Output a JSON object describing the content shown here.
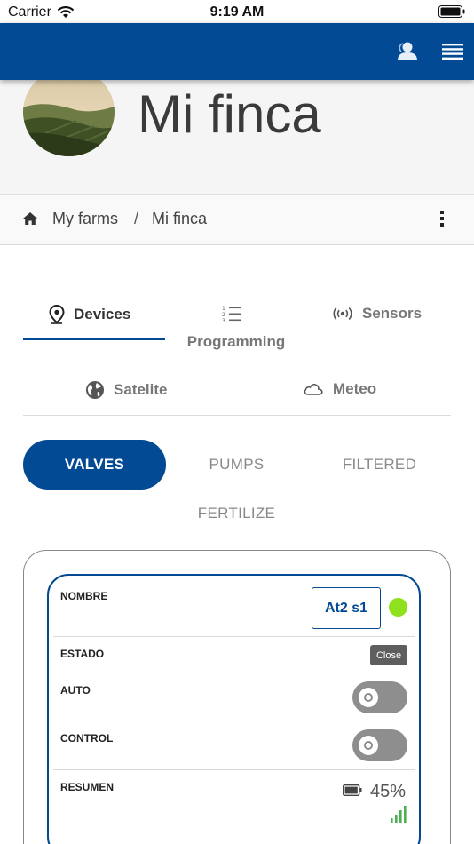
{
  "status_bar": {
    "carrier": "Carrier",
    "time": "9:19 AM"
  },
  "header": {
    "user_icon": "user-icon",
    "menu_icon": "hamburger-menu-icon",
    "brand_color": "#024a93"
  },
  "farm": {
    "title": "Mi finca"
  },
  "breadcrumb": {
    "home_icon": "home-icon",
    "item1": "My farms",
    "separator": "/",
    "item2": "Mi finca"
  },
  "tabs": {
    "devices": "Devices",
    "programming": "Programming",
    "sensors": "Sensors",
    "satelite": "Satelite",
    "meteo": "Meteo",
    "active": "devices"
  },
  "segments": {
    "valves": "VALVES",
    "pumps": "PUMPS",
    "filtered": "FILTERED",
    "fertilize": "FERTILIZE",
    "active": "valves"
  },
  "device": {
    "labels": {
      "nombre": "NOMBRE",
      "estado": "ESTADO",
      "auto": "AUTO",
      "control": "CONTROL",
      "resumen": "RESUMEN"
    },
    "name": "At2 s1",
    "status_color": "#8fe01f",
    "estado_value": "Close",
    "auto_on": false,
    "control_on": false,
    "battery": "45%",
    "signal_color": "#4caf50"
  }
}
